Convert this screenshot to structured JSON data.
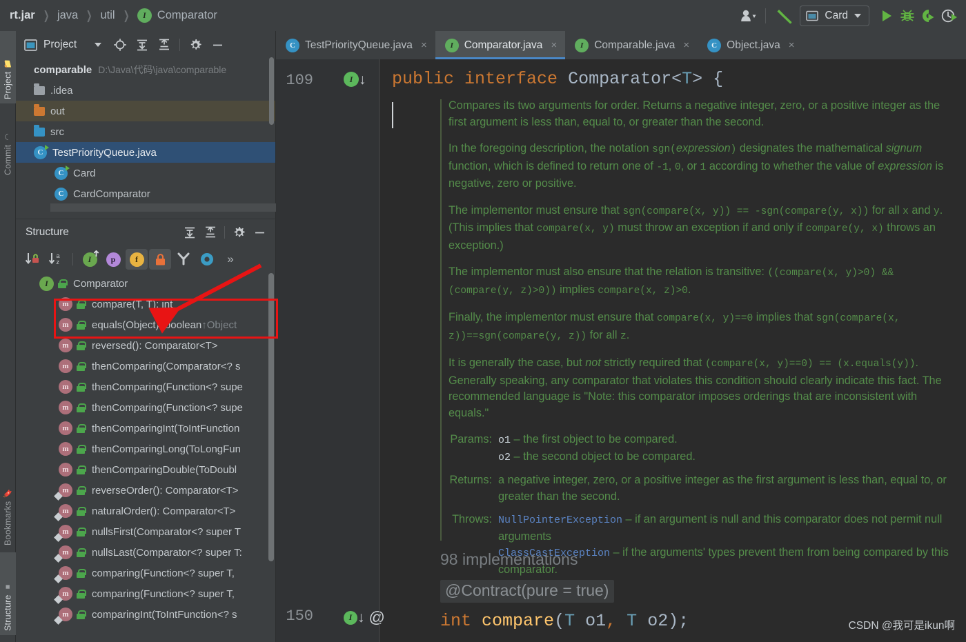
{
  "breadcrumb": {
    "items": [
      "rt.jar",
      "java",
      "util"
    ],
    "leaf": "Comparator",
    "leaf_icon": "interface-badge-icon"
  },
  "toolbar": {
    "account_icon": "person-icon",
    "account_caret": "chevron-down-icon",
    "build_icon": "hammer-icon",
    "run_config": {
      "label": "Card",
      "icon": "run-config-icon",
      "caret": "chevron-down-icon"
    },
    "run_icon": "play-icon",
    "debug_icon": "bug-icon",
    "coverage_icon": "run-with-coverage-icon",
    "profile_icon": "profiler-icon"
  },
  "left_strip": {
    "items": [
      {
        "label": "Project",
        "icon": "project-folder-icon",
        "active": true
      },
      {
        "label": "Commit",
        "icon": "commit-icon",
        "active": false
      },
      {
        "label": "Bookmarks",
        "icon": "bookmark-icon",
        "active": false
      },
      {
        "label": "Structure",
        "icon": "structure-icon",
        "active": true
      }
    ]
  },
  "project_panel": {
    "title": "Project",
    "title_icon": "project-window-icon",
    "buttons": [
      "chevron-down-icon",
      "locate-target-icon",
      "expand-all-icon",
      "collapse-all-icon",
      "gear-icon",
      "minimize-icon"
    ],
    "tree": [
      {
        "name": "comparable",
        "path": "D:\\Java\\代码\\java\\comparable",
        "kind": "module",
        "indent": 0
      },
      {
        "name": ".idea",
        "kind": "folder-grey",
        "indent": 1
      },
      {
        "name": "out",
        "kind": "folder-orange",
        "indent": 1,
        "highlight": "out"
      },
      {
        "name": "src",
        "kind": "folder-blue",
        "indent": 1
      },
      {
        "name": "TestPriorityQueue.java",
        "kind": "class-runnable",
        "indent": 1,
        "expanded": true,
        "selected": true
      },
      {
        "name": "Card",
        "kind": "class-runnable",
        "indent": 2
      },
      {
        "name": "CardComparator",
        "kind": "class",
        "indent": 2
      }
    ]
  },
  "structure_panel": {
    "title": "Structure",
    "head_buttons": [
      "expand-all-icon",
      "collapse-all-icon",
      "gear-icon",
      "minimize-icon"
    ],
    "filters": [
      {
        "name": "sort-by-visibility-icon",
        "pressed": false
      },
      {
        "name": "sort-alphabetically-icon",
        "pressed": false
      },
      {
        "name": "show-inherited-icon",
        "pressed": false,
        "glyph": "I"
      },
      {
        "name": "show-properties-icon",
        "pressed": false,
        "glyph": "p"
      },
      {
        "name": "show-fields-icon",
        "pressed": true,
        "glyph": "f"
      },
      {
        "name": "show-non-public-icon",
        "pressed": true,
        "glyph": "lock"
      },
      {
        "name": "show-anonymous-classes-icon",
        "pressed": false
      },
      {
        "name": "group-methods-icon",
        "pressed": false
      },
      {
        "name": "more-options-icon",
        "pressed": false,
        "glyph": "»"
      }
    ],
    "root": {
      "name": "Comparator",
      "icon": "interface-badge-icon"
    },
    "members": [
      {
        "label": "compare(T, T): int",
        "static": false,
        "boxed": true
      },
      {
        "label": "equals(Object): boolean ",
        "override": "↑Object",
        "static": false,
        "boxed": true
      },
      {
        "label": "reversed(): Comparator<T>",
        "static": false
      },
      {
        "label": "thenComparing(Comparator<? s",
        "static": false
      },
      {
        "label": "thenComparing(Function<? supe",
        "static": false
      },
      {
        "label": "thenComparing(Function<? supe",
        "static": false
      },
      {
        "label": "thenComparingInt(ToIntFunction",
        "static": false
      },
      {
        "label": "thenComparingLong(ToLongFun",
        "static": false
      },
      {
        "label": "thenComparingDouble(ToDoubl",
        "static": false
      },
      {
        "label": "reverseOrder(): Comparator<T>",
        "static": true
      },
      {
        "label": "naturalOrder(): Comparator<T>",
        "static": true
      },
      {
        "label": "nullsFirst(Comparator<? super T",
        "static": true
      },
      {
        "label": "nullsLast(Comparator<? super T:",
        "static": true
      },
      {
        "label": "comparing(Function<? super T, ",
        "static": true
      },
      {
        "label": "comparing(Function<? super T, ",
        "static": true
      },
      {
        "label": "comparingInt(ToIntFunction<? s",
        "static": true
      }
    ]
  },
  "editor": {
    "tabs": [
      {
        "label": "TestPriorityQueue.java",
        "kind": "class",
        "active": false,
        "close": "×"
      },
      {
        "label": "Comparator.java",
        "kind": "interface",
        "active": true,
        "close": "×"
      },
      {
        "label": "Comparable.java",
        "kind": "interface",
        "active": false,
        "close": "×"
      },
      {
        "label": "Object.java",
        "kind": "class",
        "active": false,
        "close": "×"
      }
    ],
    "gutter": {
      "top_line": "109",
      "bottom_line": "150",
      "top_icons": [
        "interface-implemented-icon",
        "arrow-down-icon"
      ],
      "bottom_icons": [
        "interface-implemented-icon",
        "arrow-down-icon",
        "annotation-icon"
      ]
    },
    "signature": {
      "kw_public": "public",
      "kw_interface": "interface",
      "type_name": "Comparator",
      "generic_open": "<",
      "generic_param": "T",
      "generic_close": ">",
      "brace": "{"
    },
    "doc": {
      "p1": "Compares its two arguments for order. Returns a negative integer, zero, or a positive integer as the first argument is less than, equal to, or greater than the second.",
      "p2_a": "In the foregoing description, the notation ",
      "p2_sgn": "sgn(",
      "p2_expr": "expression",
      "p2_close": ")",
      "p2_b": " designates the mathematical ",
      "p2_signum": "signum",
      "p2_c": " function, which is defined to return one of ",
      "p2_n1": "-1",
      "p2_d": ", ",
      "p2_zero": "0",
      "p2_e": ", or ",
      "p2_one": "1",
      "p2_f": " according to whether the value of ",
      "p2_expr2": "expression",
      "p2_g": " is negative, zero or positive.",
      "p3_a": "The implementor must ensure that ",
      "p3_m1": "sgn(compare(x, y)) == -sgn(compare(y, x))",
      "p3_b": " for all ",
      "p3_x": "x",
      "p3_c": " and ",
      "p3_y": "y",
      "p3_d": ". (This implies that ",
      "p3_m2": "compare(x, y)",
      "p3_e": " must throw an exception if and only if ",
      "p3_m3": "compare(y, x)",
      "p3_f": " throws an exception.)",
      "p4_a": "The implementor must also ensure that the relation is transitive: ",
      "p4_m1": "((compare(x, y)>0) && (compare(y, z)>0))",
      "p4_b": " implies ",
      "p4_m2": "compare(x, z)>0",
      "p4_c": ".",
      "p5_a": "Finally, the implementor must ensure that ",
      "p5_m1": "compare(x, y)==0",
      "p5_b": " implies that ",
      "p5_m2": "sgn(compare(x, z))==sgn(compare(y, z))",
      "p5_c": " for all ",
      "p5_z": "z",
      "p5_d": ".",
      "p6_a": "It is generally the case, but ",
      "p6_not": "not",
      "p6_b": " strictly required that ",
      "p6_m1": "(compare(x, y)==0) == (x.equals(y))",
      "p6_c": ". Generally speaking, any comparator that violates this condition should clearly indicate this fact. The recommended language is \"Note: this comparator imposes orderings that are inconsistent with equals.\"",
      "params_label": "Params:",
      "param1_name": "o1",
      "param1_desc": " – the first object to be compared.",
      "param2_name": "o2",
      "param2_desc": " – the second object to be compared.",
      "returns_label": "Returns:",
      "returns_desc": "a negative integer, zero, or a positive integer as the first argument is less than, equal to, or greater than the second.",
      "throws_label": "Throws:",
      "throw1_name": "NullPointerException",
      "throw1_desc": " – if an argument is null and this comparator does not permit null arguments",
      "throw2_name": "ClassCastException",
      "throw2_desc": " – if the arguments' types prevent them from being compared by this comparator."
    },
    "impl_hint": "98 implementations",
    "contract": "@Contract(pure = true)",
    "method_line": {
      "ret": "int",
      "name": "compare",
      "open": "(",
      "t1": "T",
      "p1": "o1",
      "comma": ",",
      "t2": "T",
      "p2": "o2",
      "close": ");"
    }
  },
  "watermark": "CSDN @我可是ikun啊",
  "colors": {
    "accent_blue": "#4a88c7",
    "selection_blue": "#2f5075",
    "javadoc_green": "#548c4a",
    "keyword_orange": "#cc7832",
    "method_yellow": "#ffc66d",
    "annotation_red": "#e81414",
    "editor_bg": "#2b2b2b",
    "panel_bg": "#3c3f41"
  }
}
